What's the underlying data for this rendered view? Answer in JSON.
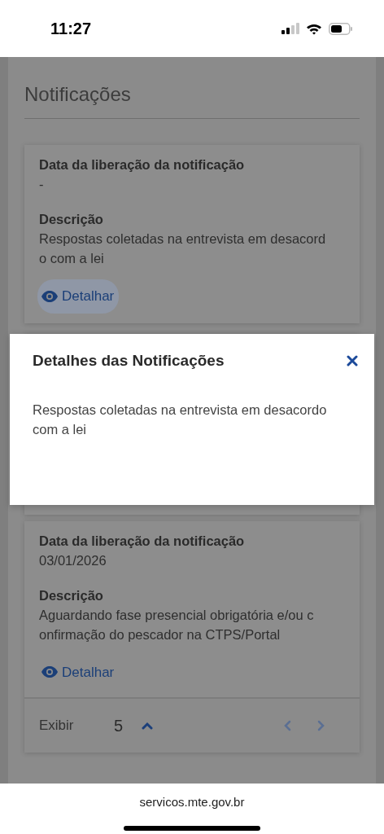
{
  "status_bar": {
    "time": "11:27"
  },
  "page": {
    "title": "Notificações"
  },
  "notifications": [
    {
      "date_label": "Data da liberação da notificação",
      "date": "-",
      "description_label": "Descrição",
      "description_lines": [
        "Respostas coletadas na entrevista em desacord",
        "o com a lei"
      ],
      "action": "Detalhar",
      "focused": true
    },
    {
      "date_label": "Data da liberação da notificação",
      "date": "03/01/2026",
      "description_label": "Descrição",
      "description_lines": [
        "Aguardando fase presencial obrigatória e/ou c",
        "onfirmação do pescador na CTPS/Portal"
      ],
      "action": "Detalhar",
      "focused": false
    }
  ],
  "pagination": {
    "label": "Exibir",
    "page_size": "5"
  },
  "modal": {
    "title": "Detalhes das Notificações",
    "text_lines": [
      "Respostas coletadas na entrevista em desacordo",
      "com a lei"
    ]
  },
  "browser": {
    "url": "servicos.mte.gov.br"
  }
}
